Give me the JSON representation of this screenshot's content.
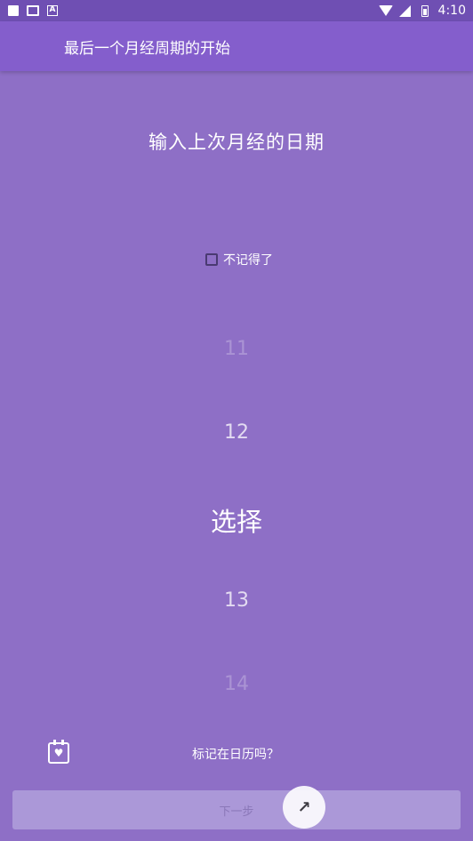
{
  "status_bar": {
    "time": "4:10",
    "left_icons": [
      "notification-icon",
      "photo-icon",
      "app-a-icon"
    ],
    "right_icons": [
      "wifi-icon",
      "signal-icon",
      "battery-icon"
    ]
  },
  "app_bar": {
    "title": "最后一个月经周期的开始"
  },
  "main": {
    "heading": "输入上次月经的日期",
    "forgot_checkbox": {
      "label": "不记得了",
      "checked": false
    },
    "picker": {
      "items": [
        "11",
        "12",
        "选择",
        "13",
        "14"
      ],
      "selected": "选择"
    },
    "calendar_prompt": "标记在日历吗？",
    "next_button": "下一步"
  }
}
